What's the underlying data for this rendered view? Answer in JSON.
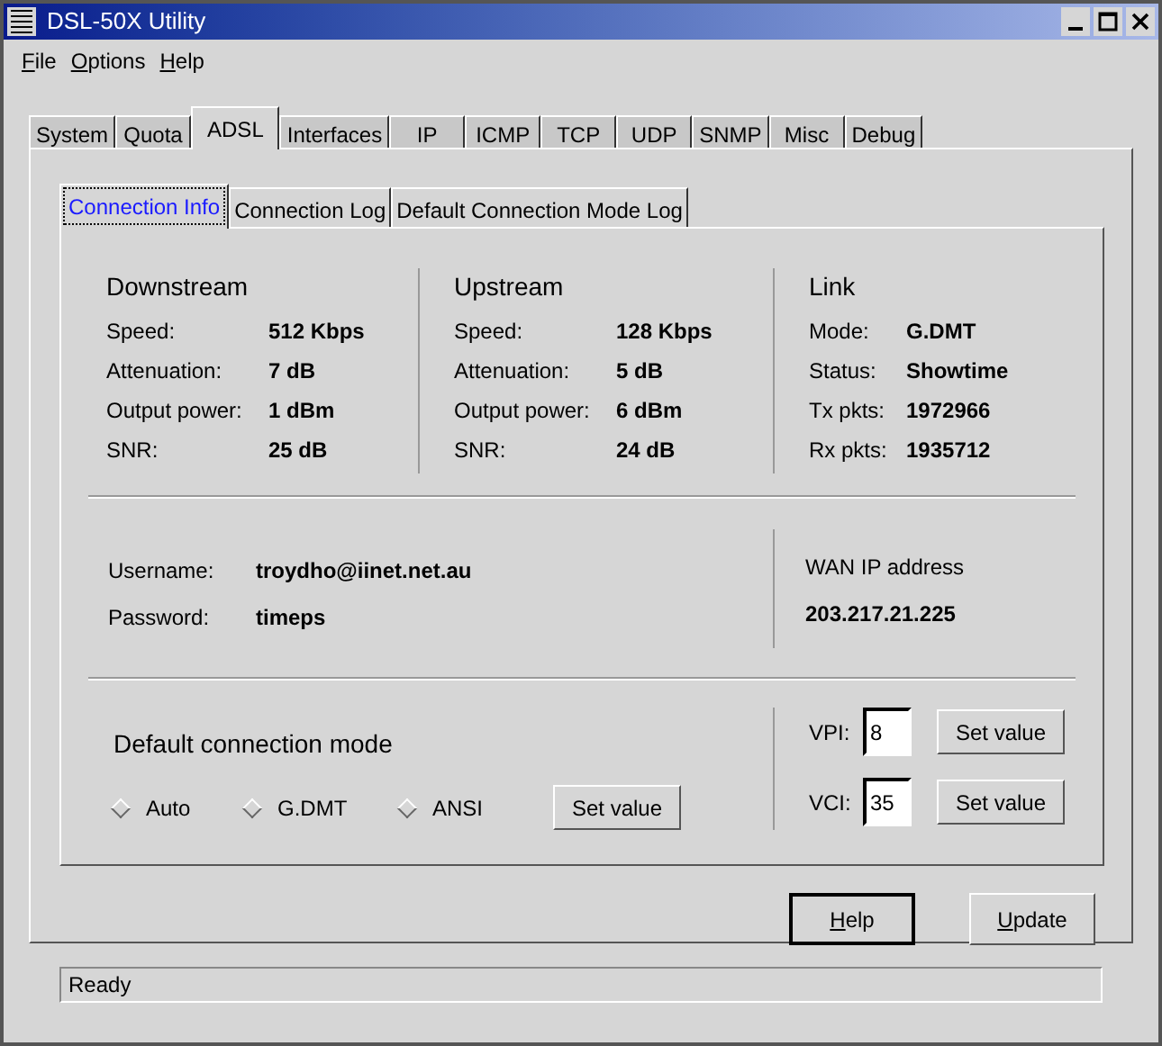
{
  "window": {
    "title": "DSL-50X Utility"
  },
  "menu": [
    "File",
    "Options",
    "Help"
  ],
  "tabs": [
    {
      "label": "System",
      "selected": false
    },
    {
      "label": "Quota",
      "selected": false
    },
    {
      "label": "ADSL",
      "selected": true
    },
    {
      "label": "Interfaces",
      "selected": false
    },
    {
      "label": "IP",
      "selected": false
    },
    {
      "label": "ICMP",
      "selected": false
    },
    {
      "label": "TCP",
      "selected": false
    },
    {
      "label": "UDP",
      "selected": false
    },
    {
      "label": "SNMP",
      "selected": false
    },
    {
      "label": "Misc",
      "selected": false
    },
    {
      "label": "Debug",
      "selected": false
    }
  ],
  "subtabs": [
    {
      "label": "Connection Info",
      "selected": true
    },
    {
      "label": "Connection Log",
      "selected": false
    },
    {
      "label": "Default Connection Mode Log",
      "selected": false
    }
  ],
  "stats": [
    {
      "title": "Downstream",
      "rows": [
        {
          "label": "Speed:",
          "value": "512 Kbps"
        },
        {
          "label": "Attenuation:",
          "value": "7 dB"
        },
        {
          "label": "Output power:",
          "value": "1 dBm"
        },
        {
          "label": "SNR:",
          "value": "25 dB"
        }
      ]
    },
    {
      "title": "Upstream",
      "rows": [
        {
          "label": "Speed:",
          "value": "128 Kbps"
        },
        {
          "label": "Attenuation:",
          "value": "5 dB"
        },
        {
          "label": "Output power:",
          "value": "6 dBm"
        },
        {
          "label": "SNR:",
          "value": "24 dB"
        }
      ]
    },
    {
      "title": "Link",
      "rows": [
        {
          "label": "Mode:",
          "value": "G.DMT"
        },
        {
          "label": "Status:",
          "value": "Showtime"
        },
        {
          "label": "Tx pkts:",
          "value": "1972966"
        },
        {
          "label": "Rx pkts:",
          "value": "1935712"
        }
      ]
    }
  ],
  "account": [
    {
      "label": "Username:",
      "value": "troydho@iinet.net.au"
    },
    {
      "label": "Password:",
      "value": "timeps"
    }
  ],
  "wan": {
    "label": "WAN IP address",
    "value": "203.217.21.225"
  },
  "connection_mode": {
    "title": "Default connection mode",
    "options": [
      {
        "label": "Auto",
        "selected": false
      },
      {
        "label": "G.DMT",
        "selected": false
      },
      {
        "label": "ANSI",
        "selected": false
      }
    ],
    "button": "Set value"
  },
  "circuit": [
    {
      "label": "VPI:",
      "value": "8",
      "button": "Set value"
    },
    {
      "label": "VCI:",
      "value": "35",
      "button": "Set value"
    }
  ],
  "buttons": [
    {
      "label": "Help",
      "focused": true
    },
    {
      "label": "Update",
      "focused": false
    }
  ],
  "status_bar": "Ready"
}
